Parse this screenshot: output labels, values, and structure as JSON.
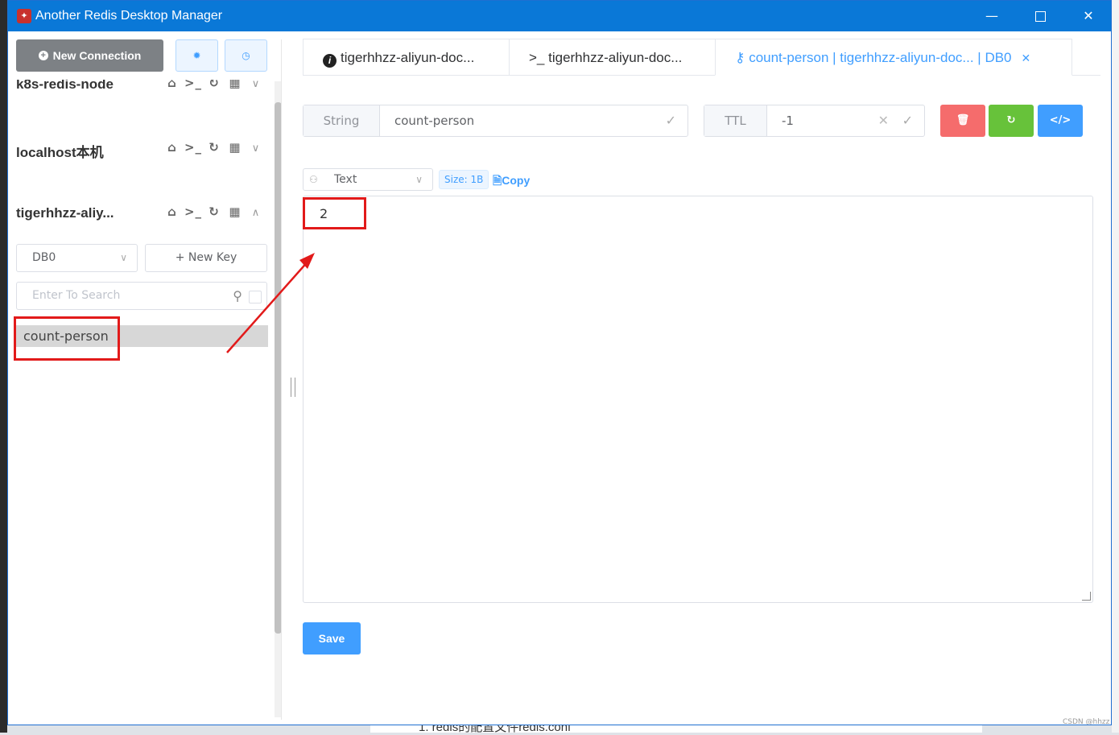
{
  "window": {
    "title": "Another Redis Desktop Manager",
    "minimize_glyph": "—",
    "close_glyph": "✕"
  },
  "sidebar": {
    "new_connection_label": "New Connection",
    "connections": [
      {
        "name": "k8s-redis-node",
        "expanded": false
      },
      {
        "name": "localhost本机",
        "expanded": false
      },
      {
        "name": "tigerhhzz-aliy...",
        "expanded": true
      }
    ],
    "db_select_value": "DB0",
    "new_key_label": "+ New Key",
    "search_placeholder": "Enter To Search",
    "keys": [
      "count-person"
    ]
  },
  "tabs": [
    {
      "label": "tigerhhzz-aliyun-doc...",
      "icon": "info-icon"
    },
    {
      "label": "tigerhhzz-aliyun-doc...",
      "icon": "terminal-icon"
    },
    {
      "label": "count-person | tigerhhzz-aliyun-doc... | DB0",
      "icon": "key-icon",
      "active": true
    }
  ],
  "key_view": {
    "type_label": "String",
    "key_name": "count-person",
    "ttl_label": "TTL",
    "ttl_value": "-1",
    "format_value": "Text",
    "size_label": "Size: 1B",
    "copy_label": "Copy",
    "value": "2",
    "save_label": "Save"
  },
  "colors": {
    "titlebar": "#0a78d7",
    "primary": "#409eff",
    "danger": "#f56c6c",
    "success": "#67c23a",
    "highlight": "#e21a1a"
  },
  "watermark": "CSDN @hhzz",
  "background_text": "1. redis的配置文件redis.conf"
}
